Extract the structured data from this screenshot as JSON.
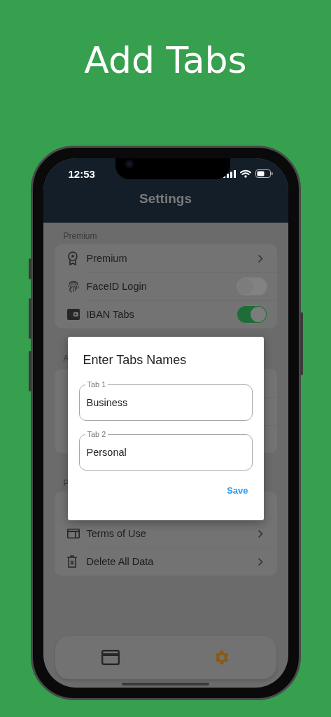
{
  "title": "Add Tabs",
  "status_bar": {
    "time": "12:53"
  },
  "header": {
    "title": "Settings"
  },
  "sections": [
    {
      "label": "Premium",
      "rows": [
        {
          "kind": "link",
          "label": "Premium"
        },
        {
          "kind": "toggle",
          "label": "FaceID Login",
          "on": false
        },
        {
          "kind": "toggle",
          "label": "IBAN Tabs",
          "on": true
        }
      ]
    },
    {
      "label": "A",
      "rows": [
        {
          "kind": "covered"
        },
        {
          "kind": "covered"
        },
        {
          "kind": "covered"
        }
      ]
    },
    {
      "label": "P",
      "rows": [
        {
          "kind": "covered"
        },
        {
          "kind": "link",
          "label": "Terms of Use"
        },
        {
          "kind": "link",
          "label": "Delete All Data"
        }
      ]
    }
  ],
  "dialog": {
    "title": "Enter Tabs Names",
    "fields": [
      {
        "label": "Tab 1",
        "value": "Business"
      },
      {
        "label": "Tab 2",
        "value": "Personal"
      }
    ],
    "action": "Save"
  },
  "nav": {
    "items": [
      {
        "selected": false
      },
      {
        "selected": true
      }
    ]
  }
}
